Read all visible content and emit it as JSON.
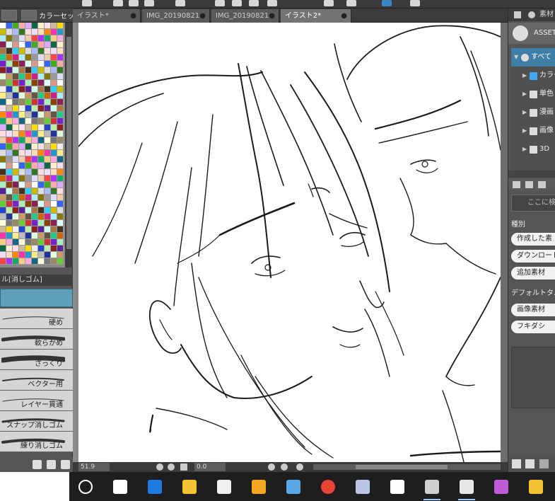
{
  "app": {
    "palette_title": "カラーセット",
    "brush_panel_title": "ル[消しゴム]"
  },
  "tabs": [
    {
      "label": "イラスト*",
      "active": false
    },
    {
      "label": "IMG_20190821",
      "active": false
    },
    {
      "label": "IMG_20190821",
      "active": false
    },
    {
      "label": "イラスト2*",
      "active": true
    }
  ],
  "brushes": [
    {
      "label": "硬め"
    },
    {
      "label": "軟らかめ"
    },
    {
      "label": "ざっくり"
    },
    {
      "label": "ベクター用"
    },
    {
      "label": "レイヤー貫通"
    },
    {
      "label": "スナップ消しゴム"
    },
    {
      "label": "練り消しゴム"
    }
  ],
  "status": {
    "zoom": "51.9",
    "rotation": "0.0"
  },
  "material_panel": {
    "header": "素材",
    "assets_label": "ASSETS",
    "tree": [
      {
        "label": "すべて",
        "icon": "all-icon",
        "selected": true
      },
      {
        "label": "カラー",
        "icon": "color-icon",
        "selected": false
      },
      {
        "label": "単色",
        "icon": "mono-icon",
        "selected": false
      },
      {
        "label": "漫画",
        "icon": "manga-icon",
        "selected": false
      },
      {
        "label": "画像",
        "icon": "image-icon",
        "selected": false
      },
      {
        "label": "3D",
        "icon": "3d-icon",
        "selected": false
      }
    ],
    "search_placeholder": "ここに検",
    "type_label": "種別",
    "filters": [
      "作成した素",
      "ダウンロード",
      "追加素材"
    ],
    "default_tags_label": "デフォルトタ...",
    "tags": [
      "画像素材",
      "フキダシ"
    ]
  },
  "taskbar": {
    "apps": [
      "cortana-icon",
      "task-view-icon",
      "edge-icon",
      "explorer-icon",
      "store-icon",
      "media-player-icon",
      "app-icon-1",
      "chrome-icon",
      "app-icon-2",
      "mail-icon",
      "clip-studio-icon",
      "clip-studio-paint-icon",
      "paint-icon",
      "app-icon-3"
    ]
  },
  "colors": {
    "selection_blue": "#3f7ea6",
    "brush_select": "#5e9fb8",
    "taskbar": "#1e1e1e"
  }
}
